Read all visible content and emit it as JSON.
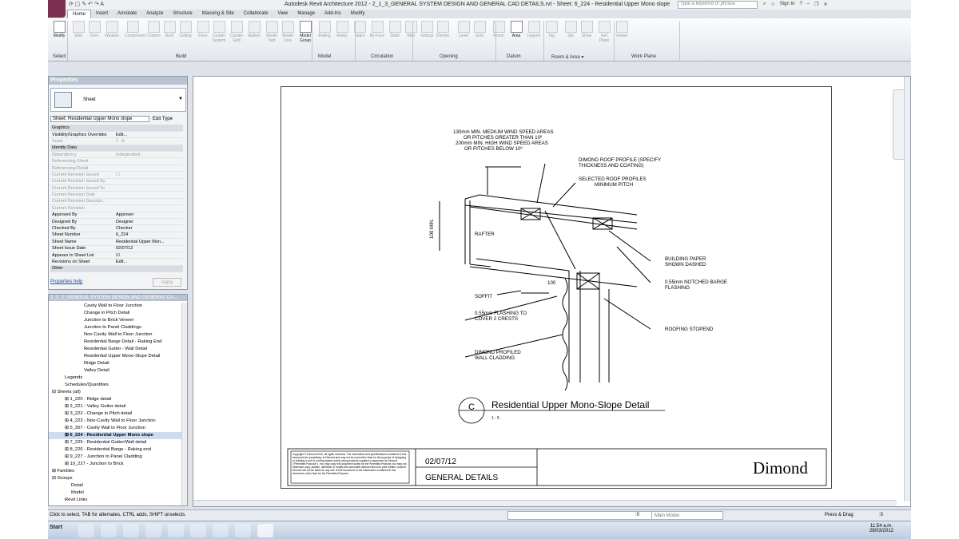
{
  "title": {
    "qat_symbols": "⟳ ▢ ✎ ↶ ↷ A",
    "text": "Autodesk Revit Architecture 2012 -   2_1_3_GENERAL SYSTEM DESIGN AND GENERAL CAD DETAILS.rvt - Sheet: 6_224 - Residential Upper Mono slope",
    "search_placeholder": "Type a keyword or phrase",
    "sign_in": "Sign In",
    "help": "?"
  },
  "tabs": [
    "Home",
    "Insert",
    "Annotate",
    "Analyze",
    "Structure",
    "Massing & Site",
    "Collaborate",
    "View",
    "Manage",
    "Add-Ins",
    "Modify"
  ],
  "ribbon": {
    "buttons": [
      {
        "label": "Modify",
        "on": true
      },
      {
        "label": "Wall"
      },
      {
        "label": "Door"
      },
      {
        "label": "Window"
      },
      {
        "label": "Component"
      },
      {
        "label": "Column"
      },
      {
        "label": "Roof"
      },
      {
        "label": "Ceiling"
      },
      {
        "label": "Floor"
      },
      {
        "label": "Curtain System"
      },
      {
        "label": "Curtain Grid"
      },
      {
        "label": "Mullion"
      },
      {
        "label": "Model Text"
      },
      {
        "label": "Model Line"
      },
      {
        "label": "Model Group",
        "on": true
      },
      {
        "label": "Railing"
      },
      {
        "label": "Ramp"
      },
      {
        "label": "Stairs"
      },
      {
        "label": "By Face"
      },
      {
        "label": "Shaft"
      },
      {
        "label": "Wall"
      },
      {
        "label": "Vertical"
      },
      {
        "label": "Dormer"
      },
      {
        "label": "Level"
      },
      {
        "label": "Grid"
      },
      {
        "label": "Room"
      },
      {
        "label": "Area",
        "on": true
      },
      {
        "label": "Legend"
      },
      {
        "label": "Tag"
      },
      {
        "label": "Set"
      },
      {
        "label": "Show"
      },
      {
        "label": "Ref Plane"
      },
      {
        "label": "Viewer"
      }
    ],
    "panels": [
      "Select",
      "Build",
      "Model",
      "Circulation",
      "Opening",
      "Datum",
      "Room & Area ▾",
      "Work Plane"
    ]
  },
  "properties": {
    "header": "Properties",
    "type_name": "Sheet",
    "sheet_selector": "Sheet: Residential Upper Mono slope",
    "edit_type": "Edit Type",
    "rows": [
      {
        "k": "Graphics",
        "v": "",
        "grp": true
      },
      {
        "k": "Visibility/Graphics Overrides",
        "v": "Edit..."
      },
      {
        "k": "Scale",
        "v": "1 : 5",
        "dim": true
      },
      {
        "k": "Identity Data",
        "v": "",
        "grp": true
      },
      {
        "k": "Dependency",
        "v": "Independent",
        "dim": true
      },
      {
        "k": "Referencing Sheet",
        "v": "",
        "dim": true
      },
      {
        "k": "Referencing Detail",
        "v": "",
        "dim": true
      },
      {
        "k": "Current Revision Issued",
        "v": "☐",
        "dim": true
      },
      {
        "k": "Current Revision Issued By",
        "v": "",
        "dim": true
      },
      {
        "k": "Current Revision Issued To",
        "v": "",
        "dim": true
      },
      {
        "k": "Current Revision Date",
        "v": "",
        "dim": true
      },
      {
        "k": "Current Revision Descript...",
        "v": "",
        "dim": true
      },
      {
        "k": "Current Revision",
        "v": "",
        "dim": true
      },
      {
        "k": "Approved By",
        "v": "Approver"
      },
      {
        "k": "Designed By",
        "v": "Designer"
      },
      {
        "k": "Checked By",
        "v": "Checker"
      },
      {
        "k": "Sheet Number",
        "v": "6_224"
      },
      {
        "k": "Sheet Name",
        "v": "Residential Upper Mon..."
      },
      {
        "k": "Sheet Issue Date",
        "v": "02/07/12"
      },
      {
        "k": "Appears In Sheet List",
        "v": "☑"
      },
      {
        "k": "Revisions on Sheet",
        "v": "Edit..."
      },
      {
        "k": "Other",
        "v": "",
        "grp": true
      }
    ],
    "help_link": "Properties help",
    "apply": "Apply"
  },
  "browser": {
    "header": "2_1_3_GENERAL SYSTEM DESIGN AND GENERAL CA...",
    "items": [
      {
        "t": "Cavity Wall to Floor Junction",
        "l": 5
      },
      {
        "t": "Change in Pitch Detail",
        "l": 5
      },
      {
        "t": "Junction to Brick Veneer",
        "l": 5
      },
      {
        "t": "Junction to Panel Claddings",
        "l": 5
      },
      {
        "t": "Non Cavity Wall to Floor Junction",
        "l": 5
      },
      {
        "t": "Residential Barge Detail - Raking End",
        "l": 5
      },
      {
        "t": "Residential Gutter - Wall Detail",
        "l": 5
      },
      {
        "t": "Residential Upper Mono-Slope Detail",
        "l": 5
      },
      {
        "t": "Ridge Detail",
        "l": 5
      },
      {
        "t": "Valley Detail",
        "l": 5
      },
      {
        "t": "Legends",
        "l": 2
      },
      {
        "t": "Schedules/Quantities",
        "l": 2
      },
      {
        "t": "⊟ Sheets (all)",
        "l": 0
      },
      {
        "t": "⊞ 1_220 - Ridge detail",
        "l": 2
      },
      {
        "t": "⊞ 2_221 - Valley Gutter detail",
        "l": 2
      },
      {
        "t": "⊞ 3_222 - Change in Pitch detail",
        "l": 2
      },
      {
        "t": "⊞ 4_223 - Non-Cavity Wall to Floor Junction",
        "l": 2
      },
      {
        "t": "⊞ 5_307 - Cavity Wall to Floor Junction",
        "l": 2
      },
      {
        "t": "⊞ 6_224 - Residential Upper Mono slope",
        "l": 2,
        "sel": true
      },
      {
        "t": "⊞ 7_225 - Residential Gutter/Wall detail",
        "l": 2
      },
      {
        "t": "⊞ 8_226 - Residential Barge - Raking end",
        "l": 2
      },
      {
        "t": "⊞ 9_227 - Junction to Panel Cladding",
        "l": 2
      },
      {
        "t": "⊞ 10_227 - Junction to Brick",
        "l": 2
      },
      {
        "t": "⊞ Families",
        "l": 0
      },
      {
        "t": "⊟ Groups",
        "l": 0
      },
      {
        "t": "Detail",
        "l": 3
      },
      {
        "t": "Model",
        "l": 3
      },
      {
        "t": "Revit Links",
        "l": 2
      }
    ]
  },
  "drawing": {
    "notes": {
      "wind": [
        "130mm MIN. MEDIUM WIND SPEED AREAS",
        "OR PITCHES GREATER THAN 10º",
        "200mm MIN. HIGH WIND SPEED AREAS",
        "OR PITCHES BELOW 10º"
      ],
      "roof_profile": [
        "DIMOND ROOF PROFILE (SPECIFY",
        "THICKNESS AND COATING)"
      ],
      "selected": [
        "SELECTED ROOF PROFILES",
        "MINIMUM PITCH"
      ],
      "min100": "100 MIN.",
      "rafter": "RAFTER",
      "building_paper": [
        "BUILDING PAPER",
        "SHOWN DASHED"
      ],
      "barge": [
        "0.55mm NOTCHED BARGE",
        "FLASHING"
      ],
      "soffit": "SOFFIT",
      "dim100": "100",
      "flashing": [
        "0.55mm FLASHING TO",
        "COVER 2 CRESTS"
      ],
      "stopend": "ROOFING STOPEND",
      "cladding": [
        "DIMOND PROFILED",
        "WALL CLADDING"
      ]
    },
    "tag_letter": "C",
    "view_title": "Residential Upper Mono-Slope Detail",
    "scale": "1 : 5",
    "copyright": "Copyright © Dimond 2012, all rights reserved. The information and specifications contained in this document are proprietary to Dimond and may not be used other than for the purpose of designing or building a roof or roofing system solely using products supplied or approved by Dimond (\"Permitted Purpose\"). You may copy this document solely for the Permitted Purpose, but may not otherwise copy, publish, distribute or modify this document without Dimond's prior written consent. Dimond will not be liable for any use of this document or the information contained in this document, other than for the Permitted Purpose.",
    "date": "02/07/12",
    "sheet_title": "GENERAL DETAILS",
    "logo": "Dimond"
  },
  "status": {
    "hint": "Click to select, TAB for alternates, CTRL adds, SHIFT unselects.",
    "zero1": ":0",
    "model": "Main Model",
    "press_drag": "Press & Drag",
    "filter": ":0"
  },
  "taskbar": {
    "start": "Start",
    "time": "11:54 a.m.",
    "date": "28/03/2012"
  }
}
